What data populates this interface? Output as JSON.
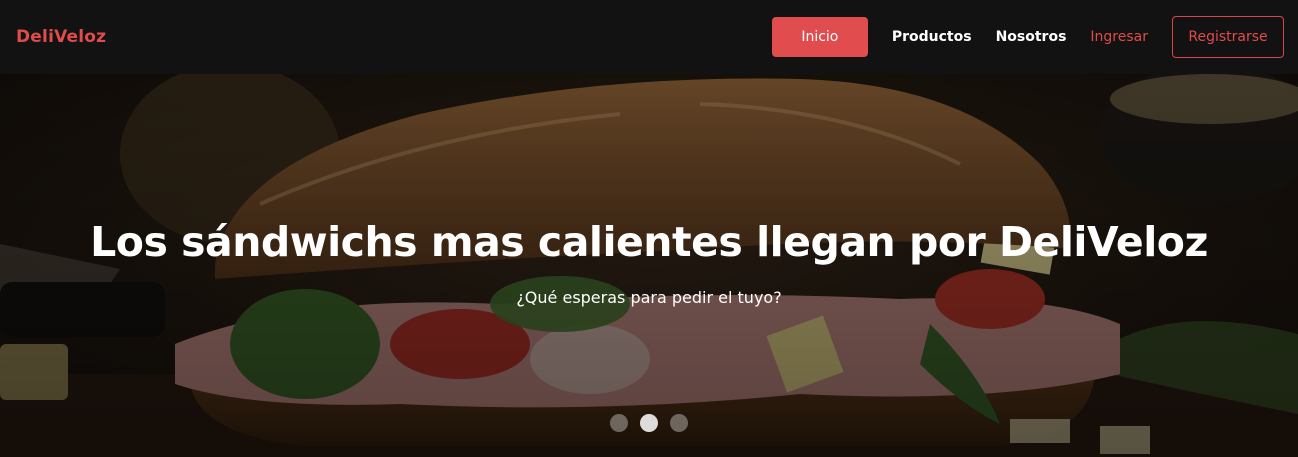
{
  "navbar": {
    "brand": "DeliVeloz",
    "links": {
      "inicio": "Inicio",
      "productos": "Productos",
      "nosotros": "Nosotros",
      "ingresar": "Ingresar",
      "registrarse": "Registrarse"
    }
  },
  "hero": {
    "title": "Los sándwichs mas calientes llegan por DeliVeloz",
    "subtitle": "¿Qué esperas para pedir el tuyo?",
    "carousel": {
      "slides": 3,
      "active_index": 1
    }
  },
  "colors": {
    "accent": "#e14c4e",
    "navbar_bg": "#121212",
    "text": "#ffffff"
  }
}
